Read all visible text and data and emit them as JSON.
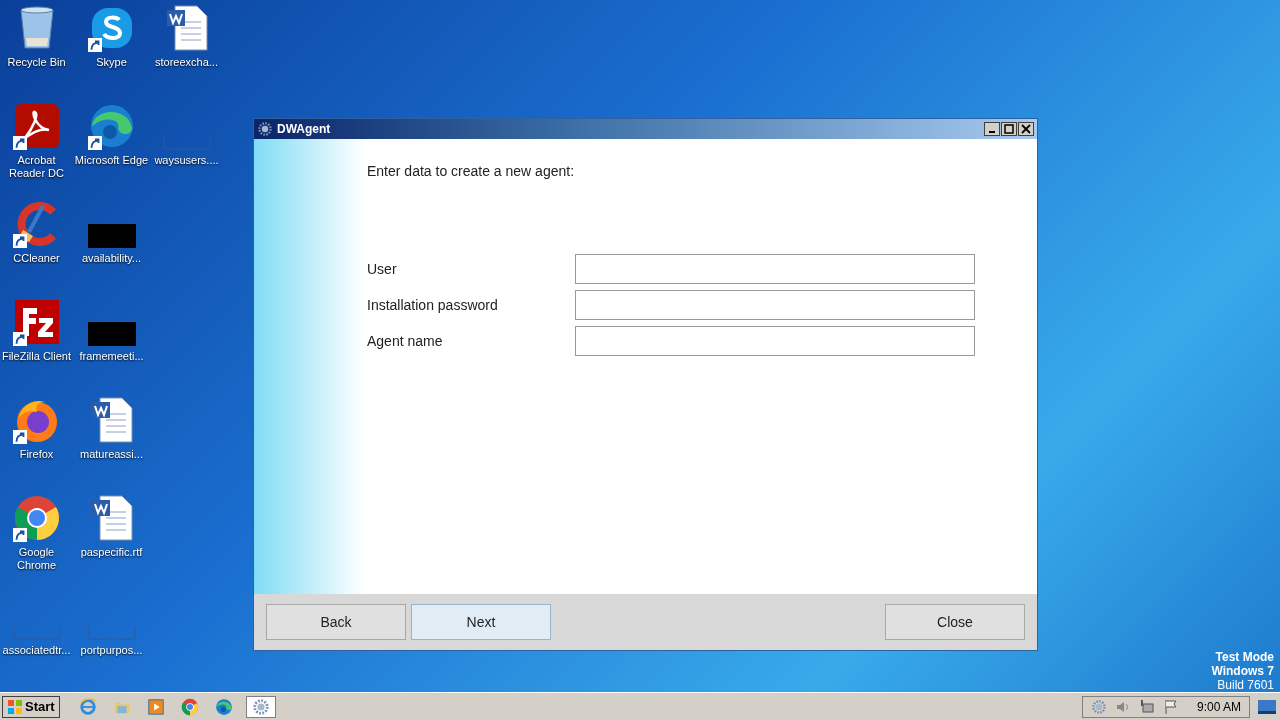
{
  "desktop": {
    "icons": [
      {
        "label": "Recycle Bin",
        "kind": "recycle",
        "shortcut": false
      },
      {
        "label": "Acrobat Reader DC",
        "kind": "acrobat",
        "shortcut": true
      },
      {
        "label": "CCleaner",
        "kind": "ccleaner",
        "shortcut": true
      },
      {
        "label": "FileZilla Client",
        "kind": "filezilla",
        "shortcut": true
      },
      {
        "label": "Firefox",
        "kind": "firefox",
        "shortcut": true
      },
      {
        "label": "Google Chrome",
        "kind": "chrome",
        "shortcut": true
      },
      {
        "label": "associatedtr...",
        "kind": "blank",
        "shortcut": false
      },
      {
        "label": "Skype",
        "kind": "skype",
        "shortcut": true
      },
      {
        "label": "Microsoft Edge",
        "kind": "edge",
        "shortcut": true
      },
      {
        "label": "availability...",
        "kind": "black",
        "shortcut": false
      },
      {
        "label": "framemeeti...",
        "kind": "black",
        "shortcut": false
      },
      {
        "label": "matureassi...",
        "kind": "word",
        "shortcut": false
      },
      {
        "label": "paspecific.rtf",
        "kind": "word",
        "shortcut": false
      },
      {
        "label": "portpurpos...",
        "kind": "blank",
        "shortcut": false
      },
      {
        "label": "storeexcha...",
        "kind": "word",
        "shortcut": false
      },
      {
        "label": "waysusers....",
        "kind": "blank",
        "shortcut": false
      }
    ],
    "watermark": [
      "Test Mode",
      "Windows 7",
      "Build 7601"
    ]
  },
  "window": {
    "title": "DWAgent",
    "heading": "Enter data to create a new agent:",
    "fields": [
      {
        "label": "User"
      },
      {
        "label": "Installation password"
      },
      {
        "label": "Agent name"
      }
    ],
    "buttons": [
      {
        "label": "Back",
        "focused": false
      },
      {
        "label": "Next",
        "focused": true
      }
    ],
    "close_button": {
      "label": "Close",
      "focused": false
    }
  },
  "taskbar": {
    "start": "Start",
    "apps": [
      {
        "kind": "ie"
      },
      {
        "kind": "explorer"
      },
      {
        "kind": "media"
      },
      {
        "kind": "chrome"
      },
      {
        "kind": "edge"
      },
      {
        "kind": "gear",
        "selected": true
      }
    ],
    "clock": "9:00 AM"
  }
}
